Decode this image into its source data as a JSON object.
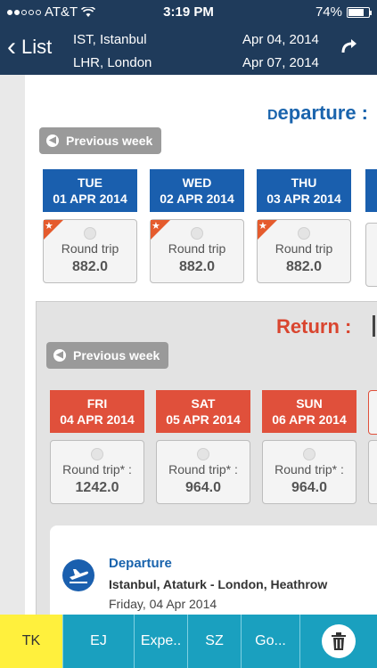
{
  "status": {
    "carrier": "AT&T",
    "time": "3:19 PM",
    "battery": "74%",
    "signal_bars": 2
  },
  "nav": {
    "back_label": "List",
    "origin": "IST, Istanbul",
    "destination": "LHR, London",
    "depart_date": "Apr 04, 2014",
    "return_date": "Apr 07, 2014",
    "refresh_icon": "refresh-icon"
  },
  "departure": {
    "title_initial": "D",
    "title_rest": "eparture :",
    "prev_week": "Previous week",
    "days": [
      {
        "dow": "TUE",
        "date": "01 APR 2014",
        "label": "Round trip",
        "price": "882.0"
      },
      {
        "dow": "WED",
        "date": "02 APR 2014",
        "label": "Round trip",
        "price": "882.0"
      },
      {
        "dow": "THU",
        "date": "03 APR 2014",
        "label": "Round trip",
        "price": "882.0"
      }
    ]
  },
  "return": {
    "title": "Return :",
    "prev_week": "Previous week",
    "days": [
      {
        "dow": "FRI",
        "date": "04 APR 2014",
        "label": "Round trip* :",
        "price": "1242.0"
      },
      {
        "dow": "SAT",
        "date": "05 APR 2014",
        "label": "Round trip* :",
        "price": "964.0"
      },
      {
        "dow": "SUN",
        "date": "06 APR 2014",
        "label": "Round trip* :",
        "price": "964.0"
      }
    ]
  },
  "flight": {
    "title": "Departure",
    "route": "Istanbul, Ataturk - London, Heathrow",
    "date": "Friday, 04 Apr 2014"
  },
  "tabs": [
    "TK",
    "EJ",
    "Expe..",
    "SZ",
    "Go..."
  ],
  "colors": {
    "nav": "#1f3b5b",
    "departure": "#1a5fae",
    "return": "#e0503b",
    "tabbar": "#1aa0bf",
    "active_tab": "#fff03d"
  }
}
